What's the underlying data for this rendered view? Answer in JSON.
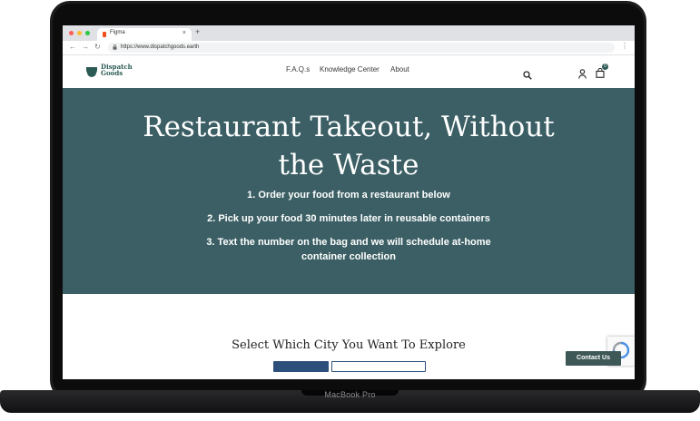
{
  "device": {
    "label": "MacBook Pro"
  },
  "browser": {
    "tab_title": "Figma",
    "tab_close": "×",
    "new_tab": "+",
    "url": "https://www.dispatchgoods.earth",
    "nav": {
      "back": "←",
      "forward": "→",
      "reload": "↻",
      "menu": "⋮"
    },
    "lock": "🔒",
    "traffic_lights": [
      "#ff5f57",
      "#febc2e",
      "#28c840"
    ]
  },
  "site": {
    "logo": {
      "line1": "Dispatch",
      "line2": "Goods"
    },
    "nav_links": [
      "F.A.Q.s",
      "Knowledge Center",
      "About"
    ],
    "icons": [
      "search-icon",
      "account-icon",
      "cart-icon"
    ],
    "cart_count": "0",
    "colors": {
      "brand": "#2b5a54",
      "hero_bg": "#3b5f64",
      "button": "#2c4f7c",
      "contact": "#3d5857"
    }
  },
  "hero": {
    "title_line1": "Restaurant Takeout, Without",
    "title_line2": "the Waste",
    "steps": [
      "1. Order your food from a restaurant below",
      "2. Pick up your food 30 minutes later in reusable containers",
      "3.  Text the number on the bag and we will schedule at-home",
      "container collection"
    ]
  },
  "section": {
    "title": "Select Which City You Want To Explore"
  },
  "contact": {
    "label": "Contact Us"
  }
}
